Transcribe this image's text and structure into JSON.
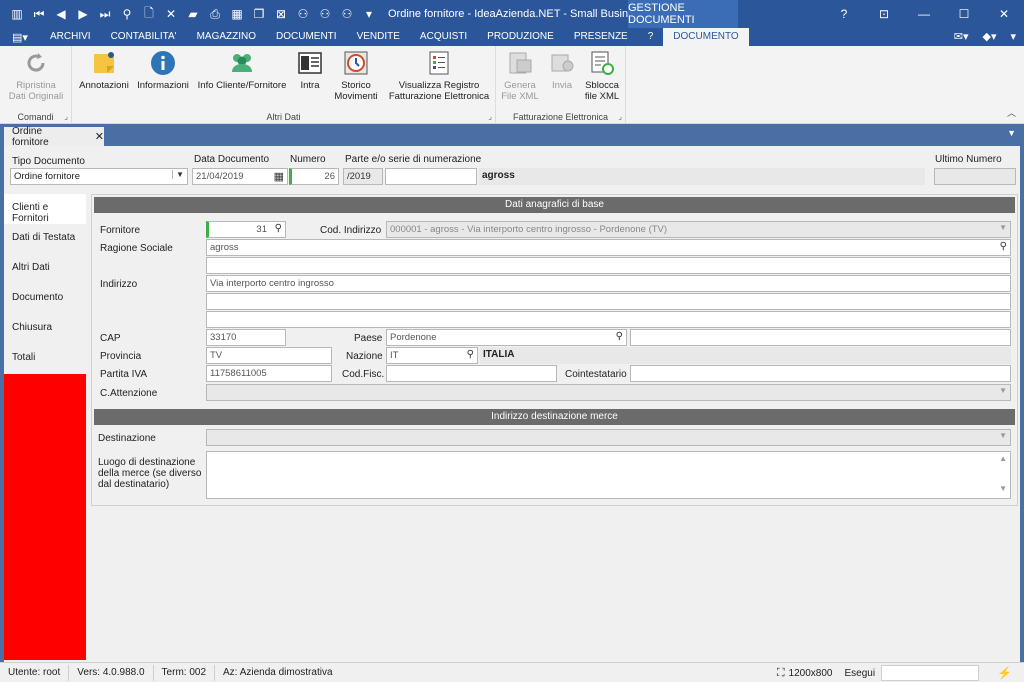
{
  "titlebar": {
    "title": "Ordine fornitore - IdeaAzienda.NET - Small Business ...",
    "context_tab": "GESTIONE DOCUMENTI",
    "qa_icons": [
      "app-icon",
      "first-icon",
      "prev-icon",
      "next-icon",
      "last-icon",
      "search-icon",
      "new-doc-icon",
      "delete-icon",
      "folder-icon",
      "print-icon",
      "calendar-icon",
      "copy-icon",
      "close-doc-icon",
      "binoculars-icon",
      "binoculars-icon",
      "binoculars-icon"
    ],
    "help": "?",
    "restore": "⊡",
    "minimize": "—",
    "maximize": "☐",
    "close": "✕"
  },
  "menu": {
    "app_button": "▤▾",
    "tabs": [
      "ARCHIVI",
      "CONTABILITA'",
      "MAGAZZINO",
      "DOCUMENTI",
      "VENDITE",
      "ACQUISTI",
      "PRODUZIONE",
      "PRESENZE",
      "?",
      "DOCUMENTO"
    ],
    "active_index": 9,
    "right_icons": [
      "✉▾",
      "◆▾",
      "▾"
    ]
  },
  "ribbon": {
    "groups": [
      {
        "label": "Comandi",
        "buttons": [
          {
            "label1": "Ripristina",
            "label2": "Dati Originali",
            "icon": "refresh-icon",
            "disabled": true
          }
        ]
      },
      {
        "label": "Altri Dati",
        "buttons": [
          {
            "label1": "Annotazioni",
            "label2": "",
            "icon": "sticky-note-icon",
            "disabled": false
          },
          {
            "label1": "Informazioni",
            "label2": "",
            "icon": "info-icon",
            "disabled": false
          },
          {
            "label1": "Info Cliente/Fornitore",
            "label2": "",
            "icon": "people-icon",
            "disabled": false
          },
          {
            "label1": "Intra",
            "label2": "",
            "icon": "intra-icon",
            "disabled": false
          },
          {
            "label1": "Storico",
            "label2": "Movimenti",
            "icon": "history-icon",
            "disabled": false
          },
          {
            "label1": "Visualizza Registro",
            "label2": "Fatturazione Elettronica",
            "icon": "register-icon",
            "disabled": false
          }
        ]
      },
      {
        "label": "Fatturazione Elettronica",
        "buttons": [
          {
            "label1": "Genera",
            "label2": "File XML",
            "icon": "generate-xml-icon",
            "disabled": true
          },
          {
            "label1": "Invia",
            "label2": "",
            "icon": "send-icon",
            "disabled": true
          },
          {
            "label1": "Sblocca",
            "label2": "file XML",
            "icon": "unlock-xml-icon",
            "disabled": false
          }
        ]
      }
    ]
  },
  "doc_tab": {
    "label": "Ordine fornitore",
    "close": "✕"
  },
  "header": {
    "tipo_label": "Tipo Documento",
    "tipo_value": "Ordine fornitore",
    "data_label": "Data Documento",
    "data_value": "21/04/2019",
    "numero_label": "Numero",
    "numero_value": "26",
    "serie_label": "Parte e/o serie di numerazione",
    "serie_value": "/2019",
    "serie_extra": "",
    "serie_name": "agross",
    "ultimo_label": "Ultimo Numero",
    "ultimo_value": ""
  },
  "side_tabs": [
    "Clienti e Fornitori",
    "Dati di Testata",
    "Altri Dati",
    "Documento",
    "Chiusura",
    "Totali"
  ],
  "form": {
    "section1": "Dati anagrafici di base",
    "fornitore_label": "Fornitore",
    "fornitore_value": "31",
    "cod_indirizzo_label": "Cod. Indirizzo",
    "cod_indirizzo_value": "000001 - agross - Via interporto centro ingrosso - Pordenone (TV)",
    "ragione_label": "Ragione Sociale",
    "ragione_value": "agross",
    "indirizzo_label": "Indirizzo",
    "indirizzo_value": "Via interporto centro ingrosso",
    "cap_label": "CAP",
    "cap_value": "33170",
    "paese_label": "Paese",
    "paese_value": "Pordenone",
    "provincia_label": "Provincia",
    "provincia_value": "TV",
    "nazione_label": "Nazione",
    "nazione_value": "IT",
    "nazione_name": "ITALIA",
    "piva_label": "Partita IVA",
    "piva_value": "11758611005",
    "codfisc_label": "Cod.Fisc.",
    "codfisc_value": "",
    "cointestatario_label": "Cointestatario",
    "cointestatario_value": "",
    "attenzione_label": "C.Attenzione",
    "section2": "Indirizzo destinazione merce",
    "destinazione_label": "Destinazione",
    "luogo_label1": "Luogo di destinazione",
    "luogo_label2": "della merce (se diverso",
    "luogo_label3": "dal destinatario)"
  },
  "status": {
    "utente": "Utente: root",
    "vers": "Vers: 4.0.988.0",
    "term": "Term: 002",
    "az": "Az: Azienda dimostrativa",
    "resolution": "1200x800",
    "esegui": "Esegui"
  },
  "colors": {
    "titlebar": "#2b579a",
    "side_panel": "#ff0000",
    "accent_green": "#3cb043"
  }
}
